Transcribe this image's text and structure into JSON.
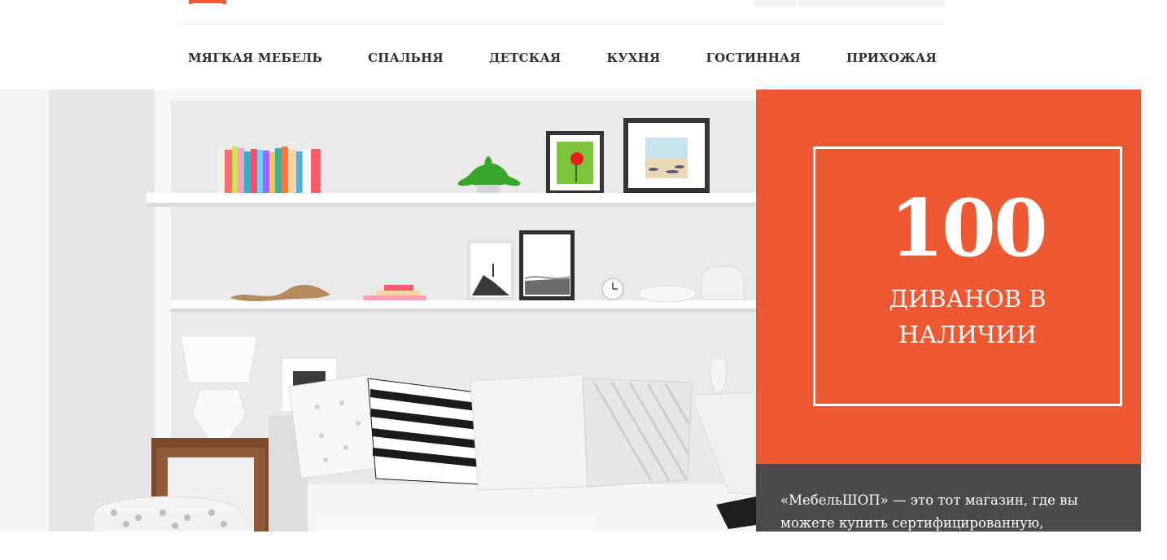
{
  "header": {
    "nav": [
      {
        "label": "МЯГКАЯ МЕБЕЛЬ"
      },
      {
        "label": "СПАЛЬНЯ"
      },
      {
        "label": "ДЕТСКАЯ"
      },
      {
        "label": "КУХНЯ"
      },
      {
        "label": "ГОСТИННАЯ"
      },
      {
        "label": "ПРИХОЖАЯ"
      }
    ]
  },
  "promo": {
    "number": "100",
    "text": "ДИВАНОВ В НАЛИЧИИ"
  },
  "about": {
    "text": "«МебельШОП» — это тот магазин, где вы можете купить сертифицированную,"
  },
  "colors": {
    "accent": "#ee5833",
    "dark_panel": "#4a4a4a",
    "nav_text": "#2e2e2e",
    "background": "#ffffff"
  },
  "icons": {
    "logo": "logo-icon"
  }
}
